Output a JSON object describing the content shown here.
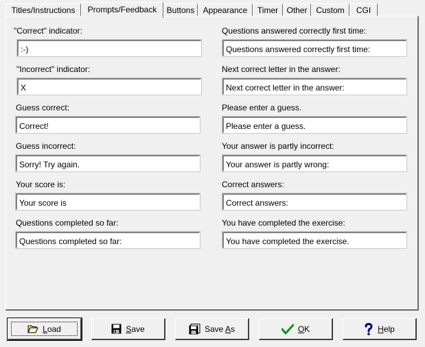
{
  "tabs": [
    {
      "label": "Titles/Instructions",
      "active": false
    },
    {
      "label": "Prompts/Feedback",
      "active": true
    },
    {
      "label": "Buttons",
      "active": false
    },
    {
      "label": "Appearance",
      "active": false
    },
    {
      "label": "Timer",
      "active": false
    },
    {
      "label": "Other",
      "active": false
    },
    {
      "label": "Custom",
      "active": false
    },
    {
      "label": "CGI",
      "active": false
    }
  ],
  "left_fields": [
    {
      "label": "\"Correct\" indicator:",
      "value": ":-)"
    },
    {
      "label": "\"Incorrect\" indicator:",
      "value": "X"
    },
    {
      "label": "Guess correct:",
      "value": "Correct!"
    },
    {
      "label": "Guess incorrect:",
      "value": "Sorry! Try again."
    },
    {
      "label": "Your score is:",
      "value": "Your score is"
    },
    {
      "label": "Questions completed so far:",
      "value": "Questions completed so far:"
    }
  ],
  "right_fields": [
    {
      "label": "Questions answered correctly first time:",
      "value": "Questions answered correctly first time:"
    },
    {
      "label": "Next correct letter in the answer:",
      "value": "Next correct letter in the answer:"
    },
    {
      "label": "Please enter a guess.",
      "value": "Please enter a guess."
    },
    {
      "label": "Your answer is partly incorrect:",
      "value": "Your answer is partly wrong:"
    },
    {
      "label": "Correct answers:",
      "value": "Correct answers:"
    },
    {
      "label": "You have completed the exercise:",
      "value": "You have completed the exercise."
    }
  ],
  "buttons": {
    "load": {
      "label": "Load",
      "icon": "folder-open-icon"
    },
    "save": {
      "label": "Save",
      "icon": "floppy-disk-icon"
    },
    "save_as": {
      "label": "Save As",
      "icon": "floppy-disk-multiple-icon"
    },
    "ok": {
      "label": "OK",
      "icon": "check-icon",
      "icon_color": "#1a8c1a"
    },
    "help": {
      "label": "Help",
      "icon": "question-icon",
      "icon_color": "#000080"
    }
  }
}
